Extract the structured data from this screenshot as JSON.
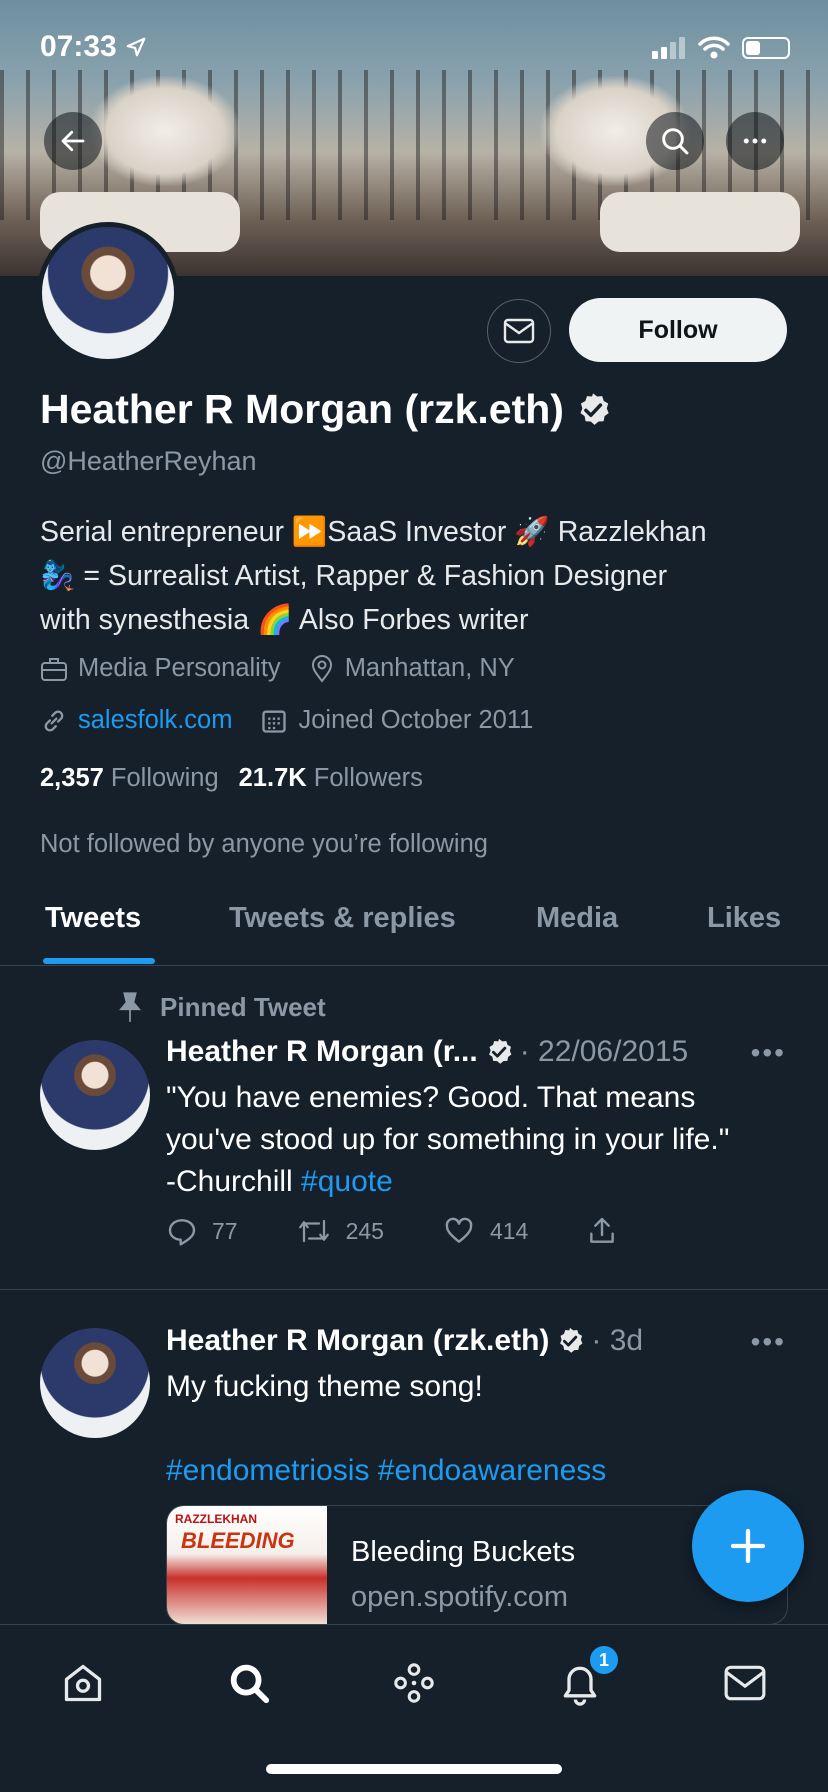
{
  "status_bar": {
    "time": "07:33"
  },
  "profile": {
    "name": "Heather R Morgan (rzk.eth)",
    "handle": "@HeatherReyhan",
    "follow_label": "Follow",
    "bio_line1": "Serial entrepreneur ⏩SaaS Investor 🚀 Razzlekhan",
    "bio_line2": "🧞‍♀️ = Surrealist Artist, Rapper & Fashion Designer",
    "bio_line3": "with synesthesia 🌈 Also Forbes writer",
    "category": "Media Personality",
    "location": "Manhattan, NY",
    "website": "salesfolk.com",
    "joined": "Joined October 2011",
    "following_count": "2,357",
    "following_label": "Following",
    "followers_count": "21.7K",
    "followers_label": "Followers",
    "not_followed": "Not followed by anyone you’re following"
  },
  "tabs": [
    {
      "label": "Tweets"
    },
    {
      "label": "Tweets & replies"
    },
    {
      "label": "Media"
    },
    {
      "label": "Likes"
    }
  ],
  "tweets": [
    {
      "pinned_label": "Pinned Tweet",
      "name": "Heather R Morgan (r...",
      "date": "· 22/06/2015",
      "text_line1": "\"You have enemies? Good. That means",
      "text_line2": "you've stood up for something in your life.\"",
      "text_line3": "-Churchill ",
      "hashtag": "#quote",
      "replies": "77",
      "retweets": "245",
      "likes": "414"
    },
    {
      "name": "Heather R Morgan (rzk.eth)",
      "date": "· 3d",
      "text": "My fucking theme song!",
      "hashtags": "#endometriosis #endoawareness",
      "card_image_text1": "RAZZLEKHAN",
      "card_image_text2": "BLEEDING",
      "card_title": "Bleeding Buckets",
      "card_domain": "open.spotify.com"
    }
  ],
  "nav": {
    "notification_badge": "1"
  },
  "colors": {
    "background": "#15202b",
    "accent": "#1d9bf0",
    "muted": "#8b98a5"
  }
}
